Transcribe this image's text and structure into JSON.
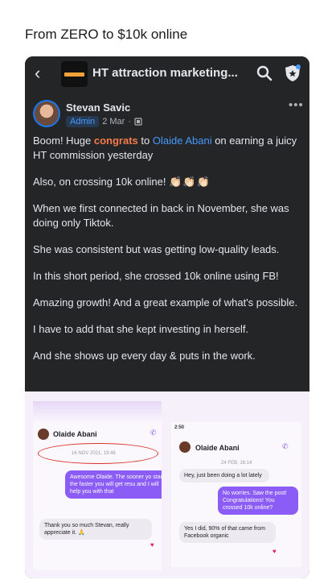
{
  "card": {
    "title": "From ZERO to $10k online"
  },
  "topbar": {
    "group_name": "HT attraction marketing..."
  },
  "post": {
    "author": "Stevan Savic",
    "role": "Admin",
    "date": "2 Mar",
    "line1_a": "Boom! Huge ",
    "line1_hl": "congrats",
    "line1_b": " to ",
    "line1_mention": "Olaide Abani",
    "line1_c": " on earning a juicy HT commission yesterday",
    "p2": "Also, on crossing 10k online!",
    "p2_emoji": "👏🏻👏🏻👏🏻",
    "p3": "When we first connected in back in November, she was doing only Tiktok.",
    "p4": "She was consistent but was getting low-quality leads.",
    "p5": "In this short period, she crossed 10k online using FB!",
    "p6": "Amazing growth! And a great example of what's possible.",
    "p7": "I have to add that she kept investing in herself.",
    "p8": "And she shows up every day & puts in the work."
  },
  "screenshot1": {
    "name": "Olaide Abani",
    "date": "16 NOV 2021, 19:46",
    "msg_out": "Awesome Olaide. The sooner yo start the faster you will get resu and I will help you with that",
    "msg_in": "Thank you so much Stevan, really appreciate it. 🙏"
  },
  "screenshot2": {
    "time": "2:50",
    "name": "Olaide Abani",
    "date": "24 FEB, 16:14",
    "msg_in1": "Hey, just been doing a lot lately",
    "msg_out": "No worries. Saw the post! Congratulations! You crossed 10k online?",
    "msg_in2": "Yes I did, 90% of that came from Facebook organic"
  },
  "colors": {
    "accent": "#4599ff",
    "highlight": "#f47b4c",
    "dark_bg": "#242526"
  }
}
